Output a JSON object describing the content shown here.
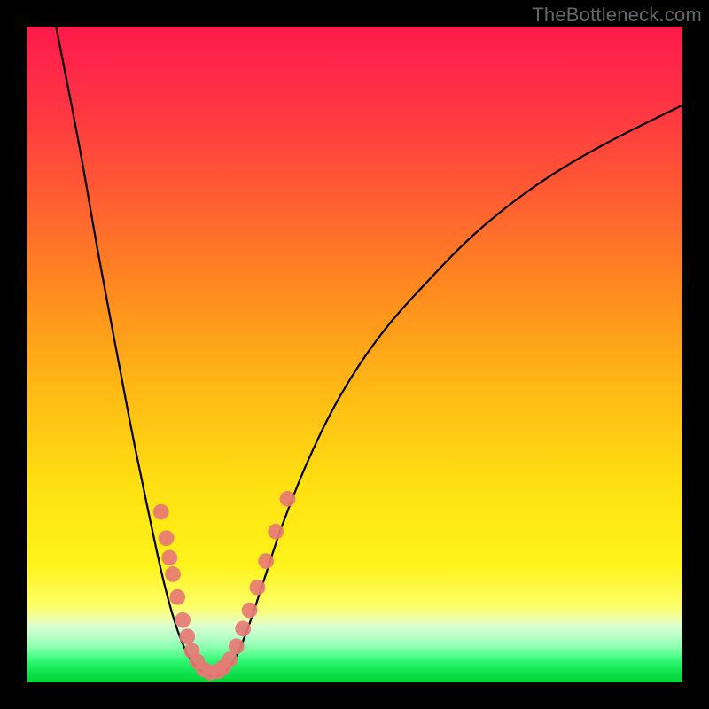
{
  "watermark": "TheBottleneck.com",
  "chart_data": {
    "type": "line",
    "title": "",
    "xlabel": "",
    "ylabel": "",
    "xlim": [
      0,
      1
    ],
    "ylim": [
      0,
      1
    ],
    "gradient_bands": [
      {
        "y0": 0.0,
        "y1": 0.9,
        "desc": "red-to-yellow vertical gradient"
      },
      {
        "y0": 0.9,
        "y1": 0.96,
        "desc": "pale green band"
      },
      {
        "y0": 0.96,
        "y1": 1.0,
        "desc": "bright green band"
      }
    ],
    "series": [
      {
        "name": "bottleneck-curve",
        "color": "#000000",
        "points": [
          {
            "x": 0.045,
            "y": 0.0
          },
          {
            "x": 0.08,
            "y": 0.18
          },
          {
            "x": 0.11,
            "y": 0.35
          },
          {
            "x": 0.14,
            "y": 0.51
          },
          {
            "x": 0.165,
            "y": 0.64
          },
          {
            "x": 0.19,
            "y": 0.76
          },
          {
            "x": 0.21,
            "y": 0.85
          },
          {
            "x": 0.23,
            "y": 0.92
          },
          {
            "x": 0.25,
            "y": 0.965
          },
          {
            "x": 0.27,
            "y": 0.985
          },
          {
            "x": 0.285,
            "y": 0.99
          },
          {
            "x": 0.3,
            "y": 0.985
          },
          {
            "x": 0.32,
            "y": 0.96
          },
          {
            "x": 0.34,
            "y": 0.91
          },
          {
            "x": 0.36,
            "y": 0.85
          },
          {
            "x": 0.39,
            "y": 0.76
          },
          {
            "x": 0.43,
            "y": 0.66
          },
          {
            "x": 0.48,
            "y": 0.56
          },
          {
            "x": 0.54,
            "y": 0.47
          },
          {
            "x": 0.61,
            "y": 0.39
          },
          {
            "x": 0.69,
            "y": 0.31
          },
          {
            "x": 0.78,
            "y": 0.24
          },
          {
            "x": 0.88,
            "y": 0.18
          },
          {
            "x": 1.0,
            "y": 0.12
          }
        ]
      }
    ],
    "scatter": {
      "name": "sample-dots",
      "color": "#e77a75",
      "radius_frac": 0.012,
      "points": [
        {
          "x": 0.205,
          "y": 0.74
        },
        {
          "x": 0.213,
          "y": 0.78
        },
        {
          "x": 0.218,
          "y": 0.81
        },
        {
          "x": 0.223,
          "y": 0.835
        },
        {
          "x": 0.23,
          "y": 0.87
        },
        {
          "x": 0.238,
          "y": 0.905
        },
        {
          "x": 0.245,
          "y": 0.93
        },
        {
          "x": 0.252,
          "y": 0.952
        },
        {
          "x": 0.26,
          "y": 0.968
        },
        {
          "x": 0.27,
          "y": 0.98
        },
        {
          "x": 0.28,
          "y": 0.985
        },
        {
          "x": 0.292,
          "y": 0.983
        },
        {
          "x": 0.3,
          "y": 0.977
        },
        {
          "x": 0.31,
          "y": 0.965
        },
        {
          "x": 0.32,
          "y": 0.945
        },
        {
          "x": 0.33,
          "y": 0.918
        },
        {
          "x": 0.34,
          "y": 0.89
        },
        {
          "x": 0.352,
          "y": 0.855
        },
        {
          "x": 0.365,
          "y": 0.815
        },
        {
          "x": 0.38,
          "y": 0.77
        },
        {
          "x": 0.398,
          "y": 0.72
        }
      ]
    },
    "gradient_stops": [
      {
        "offset": 0.0,
        "color": "#ff1a4b"
      },
      {
        "offset": 0.1,
        "color": "#ff2f46"
      },
      {
        "offset": 0.25,
        "color": "#ff5a33"
      },
      {
        "offset": 0.4,
        "color": "#ff8a1f"
      },
      {
        "offset": 0.55,
        "color": "#ffb815"
      },
      {
        "offset": 0.7,
        "color": "#ffe012"
      },
      {
        "offset": 0.82,
        "color": "#fff31a"
      },
      {
        "offset": 0.885,
        "color": "#fdff6a"
      },
      {
        "offset": 0.905,
        "color": "#ecffb0"
      },
      {
        "offset": 0.915,
        "color": "#d9ffd0"
      },
      {
        "offset": 0.93,
        "color": "#b8ffc8"
      },
      {
        "offset": 0.945,
        "color": "#8effb0"
      },
      {
        "offset": 0.958,
        "color": "#58ff8e"
      },
      {
        "offset": 0.97,
        "color": "#28f56a"
      },
      {
        "offset": 0.985,
        "color": "#0fe24e"
      },
      {
        "offset": 1.0,
        "color": "#04d336"
      }
    ]
  }
}
